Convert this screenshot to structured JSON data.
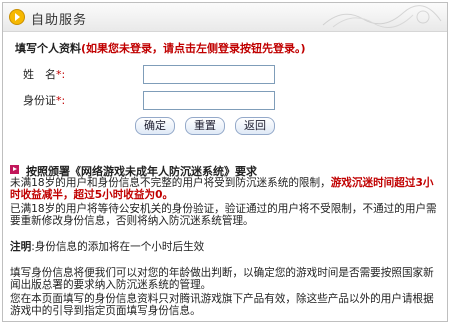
{
  "header": {
    "title": "自助服务"
  },
  "intro": {
    "prefix": "填写个人资料",
    "warning": "(如果您未登录，请点击左侧登录按钮先登录。)"
  },
  "form": {
    "name_label": "姓　名",
    "id_label": "身份证",
    "required_mark": "*:",
    "name_value": "",
    "id_value": ""
  },
  "buttons": {
    "confirm": "确定",
    "reset": "重置",
    "back": "返回"
  },
  "notice": {
    "title": "按照颁署《网络游戏未成年人防沉迷系统》要求",
    "p1_a": "未满18岁的用户和身份信息不完整的用户将受到防沉迷系统的限制，",
    "p1_red": "游戏沉迷时间超过3小时收益减半，超过5小时收益为0。",
    "p2": "已满18岁的用户将等待公安机关的身份验证，验证通过的用户将不受限制，不通过的用户需要重新修改身份信息，否则将纳入防沉迷系统管理。",
    "note_label": "注明",
    "note_text": ":身份信息的添加将在一个小时后生效",
    "p3": "填写身份信息将便我们可以对您的年龄做出判断，以确定您的游戏时间是否需要按照国家新闻出版总署的要求纳入防沉迷系统的管理。",
    "p4": "您在本页面填写的身份信息资料只对腾讯游戏旗下产品有效，除这些产品以外的用户请根据游戏中的引导到指定页面填写身份信息。"
  }
}
